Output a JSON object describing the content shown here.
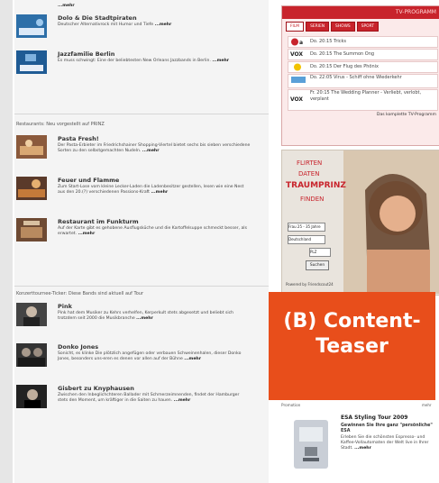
{
  "main": {
    "top_more": "...mehr",
    "items_top": [
      {
        "title": "Dolo & Die Stadtpiraten",
        "desc": "Deutscher Alternativrock mit Humor und Tiefe ",
        "more": "...mehr"
      },
      {
        "title": "Jazzfamilie Berlin",
        "desc": "Es muss schwingt: Eine der beliebtesten New Orleans Jazzbands in Berlin. ",
        "more": "...mehr"
      }
    ],
    "restaurants": {
      "heading": "Restaurants: Neu vorgestellt auf PRINZ",
      "items": [
        {
          "title": "Pasta Fresh!",
          "desc": "Der Pasta-Erbieter im Friedrichshainer Shopping-Viertel bietet sechs bis sieben verschiedene Sorten zu den selbstgemachten Nudeln. ",
          "more": "...mehr"
        },
        {
          "title": "Feuer und Flamme",
          "desc": "Zum Start-Lose vom kleine Lecker-Laden die Ladenbesitzer gestellen, lesen wie eine Nest aus den 20.(?) verschiedenen Passions-Kraft ",
          "more": "...mehr"
        },
        {
          "title": "Restaurant im Funkturm",
          "desc": "Auf der Karte gibt es gehobene Ausflugsküche und die Kartoffelsuppe schmeckt besser, als erwartet. ",
          "more": "...mehr"
        }
      ]
    },
    "concerts": {
      "heading": "Konzerttournee-Ticker: Diese Bands sind aktuell auf Tour",
      "items": [
        {
          "title": "Pink",
          "desc": "Pink hat dem Musiker zu Kehrs verhelfen, Kerperkult stets abgesetzt und beliebt sich trotzdem seit 2000 die Musikbranche ",
          "more": "...mehr"
        },
        {
          "title": "Donko Jones",
          "desc": "Sonicht, es klinke Die plötzlich angefügen oder verbauen Schweinenhalen, dieser Donko Jones, besonders uns-eren es denen vor allen auf der Bühne ",
          "more": "...mehr"
        },
        {
          "title": "Gisbert zu Knyphausen",
          "desc": "Zwischen den Inbeglichchteren Ballader mit Schmerzeimnenden, findet der Hamburger stets den Moment, um kräftiger in die Saiten zu hauen. ",
          "more": "...mehr"
        }
      ]
    }
  },
  "sidebar": {
    "tv": {
      "header": "TV-PROGRAMM",
      "tabs": [
        "FILM",
        "SERIEN",
        "SHOWS",
        "SPORT"
      ],
      "programs": [
        {
          "channel": "Arte",
          "text": "Do. 20:15 Tricks"
        },
        {
          "channel": "VOX",
          "text": "Do. 20:15 The Summon Ong"
        },
        {
          "channel": "",
          "text": "Do. 20:15 Der Flug des Phönix"
        },
        {
          "channel": "",
          "text": "Do. 22:05 Virus - Schiff ohne Wiederkehr"
        },
        {
          "channel": "VOX",
          "text": "Fr. 20:15 The Wedding Planner - Verliebt, verlobt, verplant"
        }
      ],
      "link": "Das komplette TV-Programm"
    },
    "ad": {
      "line1": "FLIRTEN",
      "line2": "DATEN",
      "line3": "TRAUMPRINZ",
      "line4": "FINDEN",
      "form": [
        "Frau 25 - 35 Jahre",
        "Deutschland",
        "PLZ",
        "Suchen"
      ],
      "footer": "Powered by Friendscout24"
    },
    "teaser": {
      "line1": "(B) Content-",
      "line2": "Teaser"
    },
    "promo": {
      "label": "Promotion",
      "more_top": "mehr",
      "title": "ESA Styling Tour 2009",
      "subtitle": "Gewinnen Sie Ihre ganz \"persönliche\" ESA",
      "desc": "Erleben Sie die schönsten Espresso- und Kaffee-Vollautomaten der Welt live in Ihrer Stadt. ",
      "more": "...mehr"
    }
  }
}
